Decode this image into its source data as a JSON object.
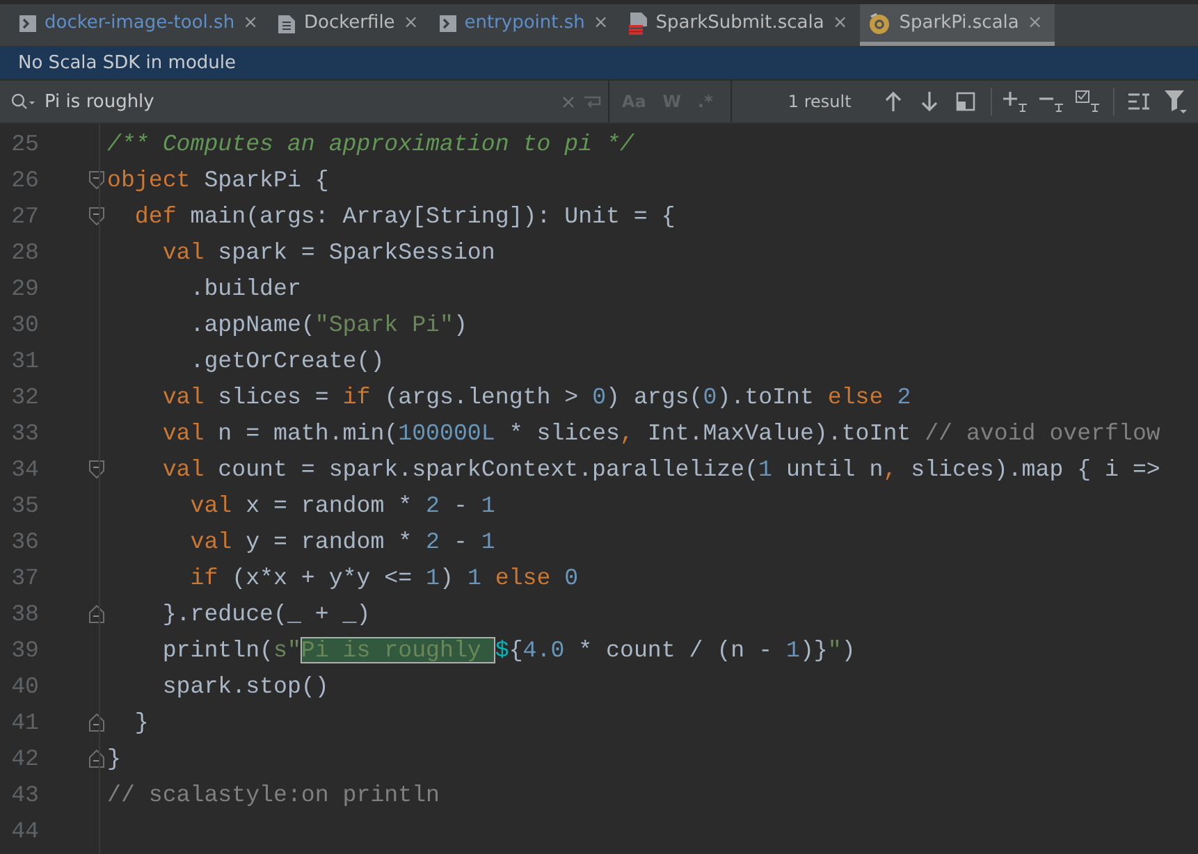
{
  "tabs": [
    {
      "label": "docker-image-tool.sh",
      "kind": "shell",
      "color": "#5d8fca",
      "close": "×",
      "selected": false
    },
    {
      "label": "Dockerfile",
      "kind": "document",
      "color": "#bbbbbb",
      "close": "×",
      "selected": false
    },
    {
      "label": "entrypoint.sh",
      "kind": "shell",
      "color": "#5d8fca",
      "close": "×",
      "selected": false
    },
    {
      "label": "SparkSubmit.scala",
      "kind": "scala-file",
      "color": "#bbbbbb",
      "close": "×",
      "selected": false
    },
    {
      "label": "SparkPi.scala",
      "kind": "scala-object",
      "color": "#bbbbbb",
      "close": "×",
      "selected": true
    }
  ],
  "notification": "No Scala SDK in module",
  "search": {
    "value": "Pi is roughly",
    "toggles": [
      {
        "label": "Aa",
        "on": false
      },
      {
        "label": "W",
        "on": false
      },
      {
        "label": ".*",
        "on": false
      }
    ],
    "result": "1 result"
  },
  "lines": [
    {
      "number": "25",
      "kind": "plain",
      "tokens": [
        {
          "kind": "doc",
          "text": "/** Computes an approximation to pi */"
        }
      ]
    },
    {
      "number": "26",
      "kind": "fold-start",
      "tokens": [
        {
          "kind": "kw",
          "text": "object"
        },
        {
          "kind": "plain",
          "text": " SparkPi {"
        }
      ]
    },
    {
      "number": "27",
      "kind": "fold-start",
      "tokens": [
        {
          "kind": "kw",
          "text": "  def"
        },
        {
          "kind": "plain",
          "text": " main(args: Array[String]): Unit = {"
        }
      ]
    },
    {
      "number": "28",
      "kind": "plain",
      "tokens": [
        {
          "kind": "kw",
          "text": "    val"
        },
        {
          "kind": "plain",
          "text": " spark = SparkSession"
        }
      ]
    },
    {
      "number": "29",
      "kind": "plain",
      "tokens": [
        {
          "kind": "plain",
          "text": "      .builder"
        }
      ]
    },
    {
      "number": "30",
      "kind": "plain",
      "tokens": [
        {
          "kind": "plain",
          "text": "      .appName("
        },
        {
          "kind": "str",
          "text": "\"Spark Pi\""
        },
        {
          "kind": "plain",
          "text": ")"
        }
      ]
    },
    {
      "number": "31",
      "kind": "plain",
      "tokens": [
        {
          "kind": "plain",
          "text": "      .getOrCreate()"
        }
      ]
    },
    {
      "number": "32",
      "kind": "plain",
      "tokens": [
        {
          "kind": "kw",
          "text": "    val"
        },
        {
          "kind": "plain",
          "text": " slices = "
        },
        {
          "kind": "kw",
          "text": "if"
        },
        {
          "kind": "plain",
          "text": " (args.length > "
        },
        {
          "kind": "num",
          "text": "0"
        },
        {
          "kind": "plain",
          "text": ") args("
        },
        {
          "kind": "num",
          "text": "0"
        },
        {
          "kind": "plain",
          "text": ").toInt "
        },
        {
          "kind": "kw",
          "text": "else "
        },
        {
          "kind": "num",
          "text": "2"
        }
      ]
    },
    {
      "number": "33",
      "kind": "plain",
      "tokens": [
        {
          "kind": "kw",
          "text": "    val"
        },
        {
          "kind": "plain",
          "text": " n = math.min("
        },
        {
          "kind": "num",
          "text": "100000L"
        },
        {
          "kind": "plain",
          "text": " * slices"
        },
        {
          "kind": "kw",
          "text": ","
        },
        {
          "kind": "plain",
          "text": " Int.MaxValue).toInt "
        },
        {
          "kind": "cmt",
          "text": "// avoid overflow"
        }
      ]
    },
    {
      "number": "34",
      "kind": "fold-start",
      "tokens": [
        {
          "kind": "kw",
          "text": "    val"
        },
        {
          "kind": "plain",
          "text": " count = spark.sparkContext.parallelize("
        },
        {
          "kind": "num",
          "text": "1"
        },
        {
          "kind": "plain",
          "text": " until n"
        },
        {
          "kind": "kw",
          "text": ","
        },
        {
          "kind": "plain",
          "text": " slices).map { i =>"
        }
      ]
    },
    {
      "number": "35",
      "kind": "plain",
      "tokens": [
        {
          "kind": "kw",
          "text": "      val"
        },
        {
          "kind": "plain",
          "text": " x = random * "
        },
        {
          "kind": "num",
          "text": "2"
        },
        {
          "kind": "plain",
          "text": " - "
        },
        {
          "kind": "num",
          "text": "1"
        }
      ]
    },
    {
      "number": "36",
      "kind": "plain",
      "tokens": [
        {
          "kind": "kw",
          "text": "      val"
        },
        {
          "kind": "plain",
          "text": " y = random * "
        },
        {
          "kind": "num",
          "text": "2"
        },
        {
          "kind": "plain",
          "text": " - "
        },
        {
          "kind": "num",
          "text": "1"
        }
      ]
    },
    {
      "number": "37",
      "kind": "plain",
      "tokens": [
        {
          "kind": "kw",
          "text": "      if"
        },
        {
          "kind": "plain",
          "text": " (x*x + y*y <= "
        },
        {
          "kind": "num",
          "text": "1"
        },
        {
          "kind": "plain",
          "text": ") "
        },
        {
          "kind": "num",
          "text": "1"
        },
        {
          "kind": "kw",
          "text": " else "
        },
        {
          "kind": "num",
          "text": "0"
        }
      ]
    },
    {
      "number": "38",
      "kind": "fold-end",
      "tokens": [
        {
          "kind": "plain",
          "text": "    }.reduce(_ + _)"
        }
      ]
    },
    {
      "number": "39",
      "kind": "plain",
      "tokens": [
        {
          "kind": "plain",
          "text": "    println("
        },
        {
          "kind": "str",
          "text": "s\""
        },
        {
          "kind": "match",
          "text": "Pi is roughly "
        },
        {
          "kind": "interp",
          "text": "$"
        },
        {
          "kind": "plain",
          "text": "{"
        },
        {
          "kind": "num",
          "text": "4.0"
        },
        {
          "kind": "plain",
          "text": " * count / (n - "
        },
        {
          "kind": "num",
          "text": "1"
        },
        {
          "kind": "plain",
          "text": ")}"
        },
        {
          "kind": "str",
          "text": "\""
        },
        {
          "kind": "plain",
          "text": ")"
        }
      ]
    },
    {
      "number": "40",
      "kind": "plain",
      "tokens": [
        {
          "kind": "plain",
          "text": "    spark.stop()"
        }
      ]
    },
    {
      "number": "41",
      "kind": "fold-end",
      "tokens": [
        {
          "kind": "plain",
          "text": "  }"
        }
      ]
    },
    {
      "number": "42",
      "kind": "fold-end",
      "tokens": [
        {
          "kind": "plain",
          "text": "}"
        }
      ]
    },
    {
      "number": "43",
      "kind": "plain",
      "tokens": [
        {
          "kind": "cmt",
          "text": "// scalastyle:on println"
        }
      ]
    },
    {
      "number": "44",
      "kind": "plain"
    }
  ]
}
